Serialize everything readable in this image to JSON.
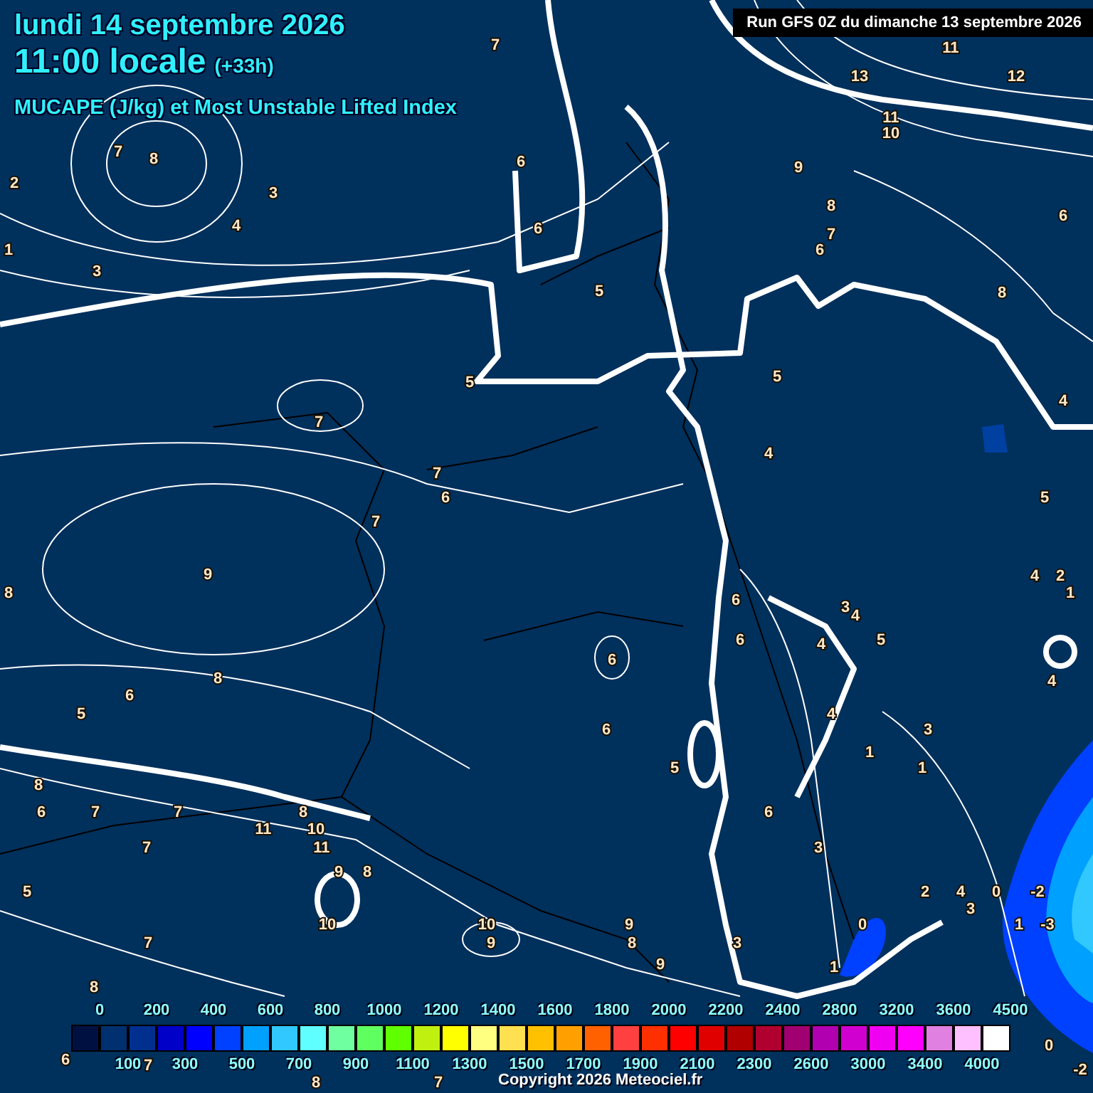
{
  "header": {
    "date": "lundi 14 septembre 2026",
    "time": "11:00 locale",
    "offset": "(+33h)",
    "subtitle": "MUCAPE (J/kg) et Most Unstable Lifted Index"
  },
  "run_info": "Run GFS 0Z du dimanche 13 septembre 2026",
  "contour_labels": [
    "7",
    "11",
    "13",
    "12",
    "11",
    "10",
    "7",
    "8",
    "6",
    "9",
    "2",
    "3",
    "8",
    "6",
    "4",
    "6",
    "7",
    "1",
    "6",
    "3",
    "5",
    "8",
    "5",
    "5",
    "4",
    "7",
    "4",
    "7",
    "6",
    "5",
    "7",
    "9",
    "4",
    "2",
    "8",
    "1",
    "6",
    "3",
    "4",
    "6",
    "4",
    "5",
    "6",
    "8",
    "4",
    "6",
    "5",
    "4",
    "6",
    "3",
    "1",
    "5",
    "1",
    "8",
    "6",
    "7",
    "7",
    "8",
    "6",
    "11",
    "10",
    "7",
    "11",
    "3",
    "9",
    "8",
    "5",
    "2",
    "4",
    "0",
    "-2",
    "3",
    "10",
    "10",
    "9",
    "0",
    "1",
    "-3",
    "7",
    "9",
    "8",
    "3",
    "9",
    "1",
    "8",
    "0",
    "6",
    "7",
    "-2",
    "8",
    "7"
  ],
  "legend": {
    "items": [
      {
        "label": "0",
        "color": "#001040"
      },
      {
        "label": "100",
        "color": "#003070"
      },
      {
        "label": "200",
        "color": "#002f8f"
      },
      {
        "label": "300",
        "color": "#0000c8"
      },
      {
        "label": "400",
        "color": "#0000ff"
      },
      {
        "label": "500",
        "color": "#0040ff"
      },
      {
        "label": "600",
        "color": "#00a0ff"
      },
      {
        "label": "700",
        "color": "#30c8ff"
      },
      {
        "label": "800",
        "color": "#60ffff"
      },
      {
        "label": "900",
        "color": "#70ffa0"
      },
      {
        "label": "1000",
        "color": "#60ff60"
      },
      {
        "label": "1100",
        "color": "#60ff00"
      },
      {
        "label": "1200",
        "color": "#c0f010"
      },
      {
        "label": "1300",
        "color": "#ffff00"
      },
      {
        "label": "1400",
        "color": "#ffff80"
      },
      {
        "label": "1500",
        "color": "#ffe050"
      },
      {
        "label": "1600",
        "color": "#ffc000"
      },
      {
        "label": "1700",
        "color": "#ffa000"
      },
      {
        "label": "1800",
        "color": "#ff6000"
      },
      {
        "label": "1900",
        "color": "#ff4040"
      },
      {
        "label": "2000",
        "color": "#ff3000"
      },
      {
        "label": "2100",
        "color": "#ff0000"
      },
      {
        "label": "2200",
        "color": "#e00000"
      },
      {
        "label": "2300",
        "color": "#b00000"
      },
      {
        "label": "2400",
        "color": "#b00030"
      },
      {
        "label": "2600",
        "color": "#a00070"
      },
      {
        "label": "2800",
        "color": "#b000b0"
      },
      {
        "label": "3000",
        "color": "#d000d0"
      },
      {
        "label": "3200",
        "color": "#f000f0"
      },
      {
        "label": "3400",
        "color": "#ff00ff"
      },
      {
        "label": "3600",
        "color": "#e080e0"
      },
      {
        "label": "4000",
        "color": "#ffc0ff"
      },
      {
        "label": "4500",
        "color": "#ffffff"
      }
    ]
  },
  "copyright": "Copyright 2026 Meteociel.fr"
}
